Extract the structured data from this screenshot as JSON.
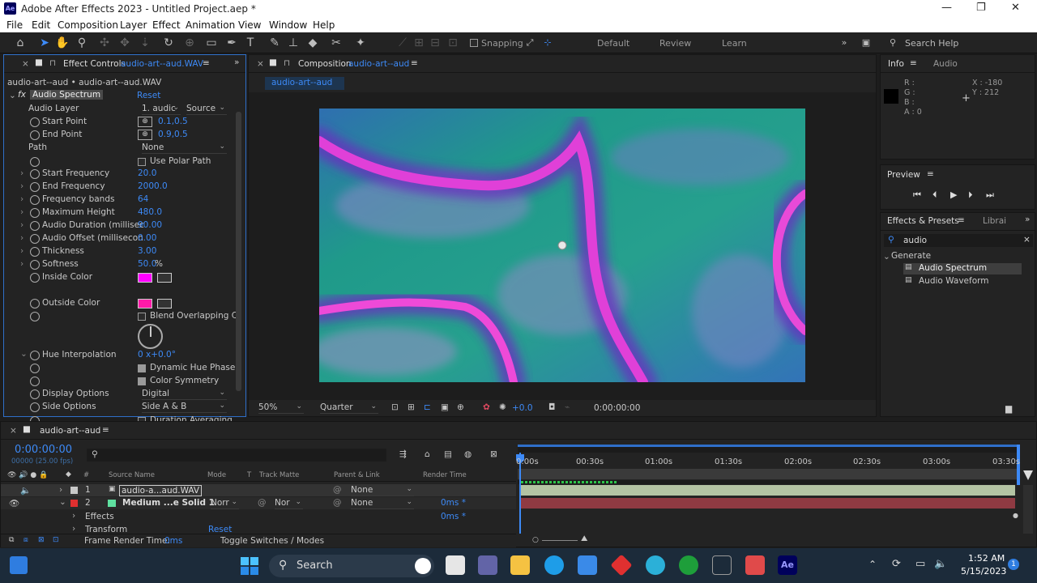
{
  "title_bar": {
    "app_icon": "Ae",
    "title": "Adobe After Effects 2023 - Untitled Project.aep *",
    "minimize": "—",
    "maximize": "❐",
    "close": "✕"
  },
  "menu": [
    "File",
    "Edit",
    "Composition",
    "Layer",
    "Effect",
    "Animation",
    "View",
    "Window",
    "Help"
  ],
  "toolbar": {
    "snapping_label": "Snapping",
    "workspaces": [
      "Default",
      "Review",
      "Learn"
    ],
    "search_help": "Search Help"
  },
  "effect_controls": {
    "tab_label": "Effect Controls",
    "tab_file": "audio-art--aud.WAV",
    "breadcrumb": "audio-art--aud • audio-art--aud.WAV",
    "effect_name": "Audio Spectrum",
    "reset": "Reset",
    "rows": [
      {
        "label": "Audio Layer",
        "value": "1. audic",
        "value2": "Source"
      },
      {
        "label": "Start Point",
        "value": "0.1,0.5"
      },
      {
        "label": "End Point",
        "value": "0.9,0.5"
      },
      {
        "label": "Path",
        "value": "None"
      },
      {
        "label": "",
        "value": "Use Polar Path"
      },
      {
        "label": "Start Frequency",
        "value": "20.0"
      },
      {
        "label": "End Frequency",
        "value": "2000.0"
      },
      {
        "label": "Frequency bands",
        "value": "64"
      },
      {
        "label": "Maximum Height",
        "value": "480.0"
      },
      {
        "label": "Audio Duration (millisec",
        "value": "90.00"
      },
      {
        "label": "Audio Offset (millisecon",
        "value": "0.00"
      },
      {
        "label": "Thickness",
        "value": "3.00"
      },
      {
        "label": "Softness",
        "value": "50.0",
        "unit": "%"
      },
      {
        "label": "Inside Color",
        "color": "#ff00ff"
      },
      {
        "label": "Outside Color",
        "color": "#ff1aa8"
      },
      {
        "label": "",
        "value": "Blend Overlapping C"
      },
      {
        "label": "Hue Interpolation",
        "value": "0 x+0.0°"
      },
      {
        "label": "",
        "value": "Dynamic Hue Phase"
      },
      {
        "label": "",
        "value": "Color Symmetry"
      },
      {
        "label": "Display Options",
        "value": "Digital"
      },
      {
        "label": "Side Options",
        "value": "Side A & B"
      },
      {
        "label": "",
        "value": "Duration Averaging"
      }
    ]
  },
  "composition": {
    "tab_label": "Composition",
    "tab_name": "audio-art--aud",
    "sub_tab": "audio-art--aud",
    "zoom": "50%",
    "resolution": "Quarter",
    "exposure": "+0.0",
    "timecode": "0:00:00:00"
  },
  "info": {
    "tab": "Info",
    "tab2": "Audio",
    "r": "R :",
    "g": "G :",
    "b": "B :",
    "a": "A : 0",
    "x": "X : -180",
    "y": "Y : 212"
  },
  "preview": {
    "title": "Preview"
  },
  "effects_presets": {
    "title": "Effects & Presets",
    "tab2": "Librai",
    "search": "audio",
    "group": "Generate",
    "items": [
      "Audio Spectrum",
      "Audio Waveform"
    ]
  },
  "timeline": {
    "tab": "audio-art--aud",
    "timecode": "0:00:00:00",
    "fps": "00000 (25.00 fps)",
    "columns": [
      "#",
      "Source Name",
      "Mode",
      "T",
      "Track Matte",
      "Parent & Link",
      "Render Time"
    ],
    "layers": [
      {
        "num": "1",
        "name": "audio-a...aud.WAV",
        "color": "#c8c8c8",
        "mode": "",
        "matte": "",
        "parent": "None",
        "render": ""
      },
      {
        "num": "2",
        "name": "Medium ...e Solid 1",
        "color": "#e03030",
        "mode": "Norr",
        "matte": "Nor",
        "parent": "None",
        "render": "0ms *"
      }
    ],
    "sub_effects": "Effects",
    "sub_effects_time": "0ms *",
    "sub_transform": "Transform",
    "sub_transform_reset": "Reset",
    "ruler": [
      "0:00s",
      "00:30s",
      "01:00s",
      "01:30s",
      "02:00s",
      "02:30s",
      "03:00s",
      "03:30s"
    ],
    "frame_render_label": "Frame Render Time:",
    "frame_render_value": "0ms",
    "toggle_label": "Toggle Switches / Modes"
  },
  "taskbar": {
    "search": "Search",
    "time": "1:52 AM",
    "date": "5/15/2023",
    "notif": "1"
  }
}
